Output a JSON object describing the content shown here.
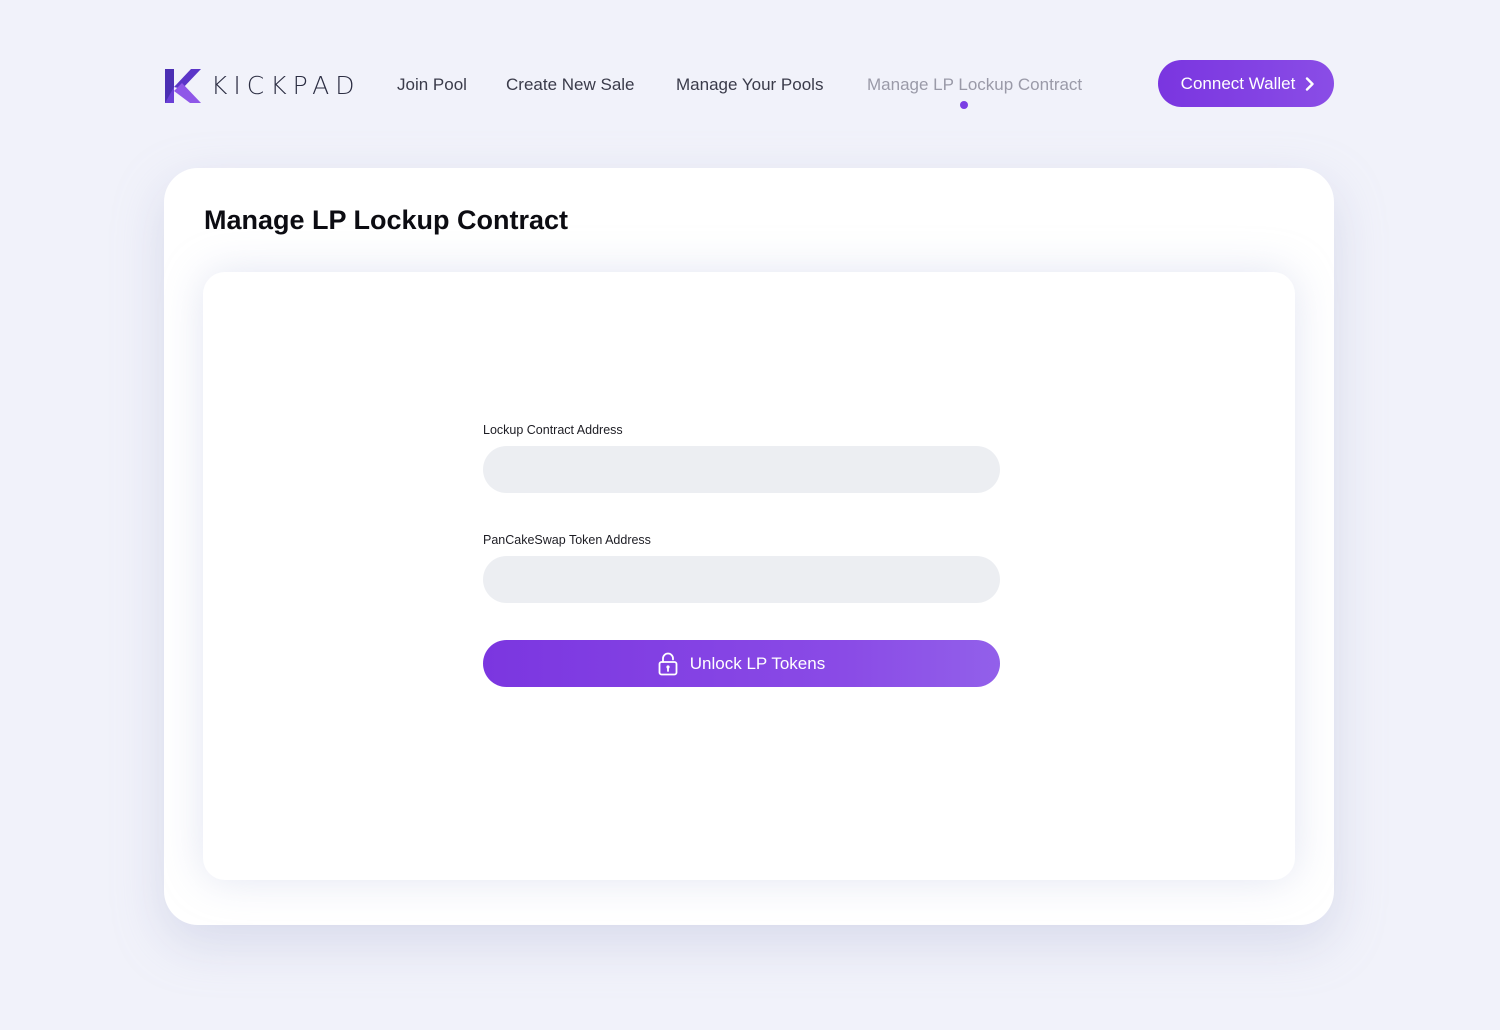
{
  "brand": {
    "name": "KICKPAD",
    "logo_icon": "kickpad-k-logo",
    "accent_color": "#7b3fe4",
    "logo_color_dark": "#4b2fb3",
    "logo_color_light": "#8f57e8"
  },
  "nav": {
    "items": [
      {
        "label": "Join Pool",
        "active": false
      },
      {
        "label": "Create New Sale",
        "active": false
      },
      {
        "label": "Manage Your Pools",
        "active": false
      },
      {
        "label": "Manage LP Lockup Contract",
        "active": true
      }
    ],
    "active_indicator": "dot"
  },
  "header": {
    "connect_wallet_label": "Connect Wallet",
    "connect_wallet_icon": "chevron-right-icon"
  },
  "main": {
    "title": "Manage LP Lockup Contract",
    "form": {
      "lockup_address": {
        "label": "Lockup Contract Address",
        "value": "",
        "placeholder": ""
      },
      "token_address": {
        "label": "PanCakeSwap Token Address",
        "value": "",
        "placeholder": ""
      },
      "submit": {
        "label": "Unlock LP Tokens",
        "icon": "unlock-icon"
      }
    }
  },
  "colors": {
    "page_background": "#f1f2fa",
    "card_background": "#ffffff",
    "input_background": "#eceef2",
    "nav_text": "#3a3b4a",
    "nav_active_text": "#9a9aa8"
  }
}
